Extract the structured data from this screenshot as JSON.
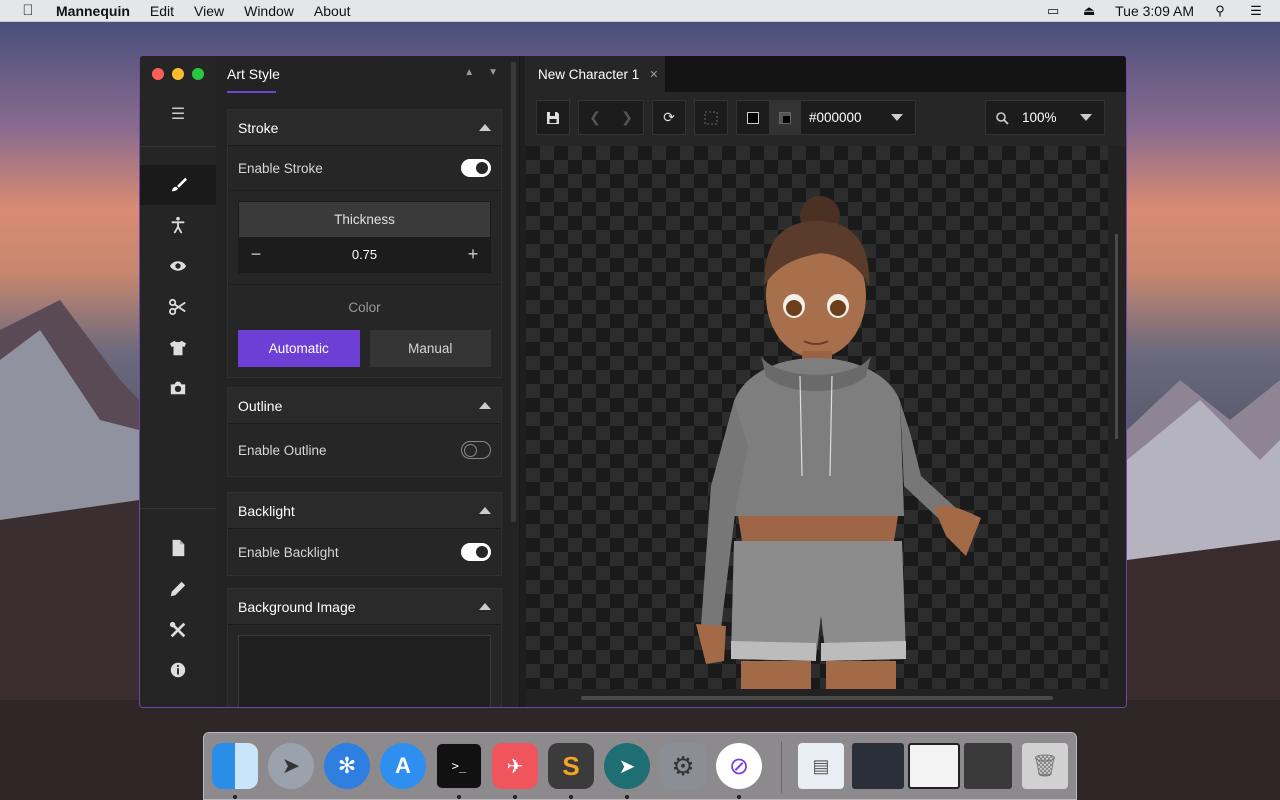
{
  "menubar": {
    "app_name": "Mannequin",
    "items": [
      "Edit",
      "View",
      "Window",
      "About"
    ],
    "clock": "Tue 3:09 AM"
  },
  "panel": {
    "title": "Art Style",
    "stroke": {
      "title": "Stroke",
      "enable_label": "Enable Stroke",
      "enabled": true,
      "thickness_label": "Thickness",
      "thickness_value": "0.75",
      "color_label": "Color",
      "color_options": [
        "Automatic",
        "Manual"
      ],
      "color_selected": "Automatic"
    },
    "outline": {
      "title": "Outline",
      "enable_label": "Enable Outline",
      "enabled": false
    },
    "backlight": {
      "title": "Backlight",
      "enable_label": "Enable Backlight",
      "enabled": true
    },
    "background_image": {
      "title": "Background Image"
    }
  },
  "canvas": {
    "tab_label": "New Character 1",
    "color_hex": "#000000",
    "zoom": "100%"
  },
  "colors": {
    "accent": "#6e3fd4",
    "window_border": "#6a4aa6",
    "background_color": "#000000"
  },
  "icons": {
    "rail_top": [
      "brush-icon",
      "person-icon",
      "eye-icon",
      "scissors-icon",
      "shirt-icon",
      "camera-icon"
    ],
    "rail_bottom": [
      "file-icon",
      "pencil-icon",
      "tools-icon",
      "info-icon"
    ],
    "dock": [
      "finder-icon",
      "launchpad-icon",
      "safari-icon",
      "app-store-icon",
      "terminal-icon",
      "game-app-icon",
      "sublime-text-icon",
      "send-app-icon",
      "system-preferences-icon",
      "mannequin-app-icon",
      "preview-icon",
      "window-thumbnail-1",
      "window-thumbnail-2",
      "window-thumbnail-3",
      "trash-icon"
    ]
  }
}
